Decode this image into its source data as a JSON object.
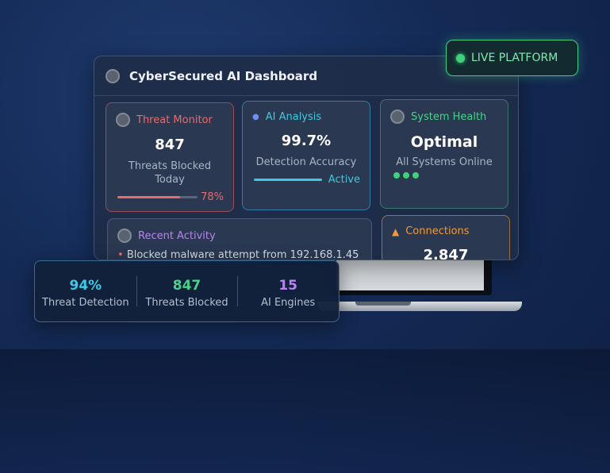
{
  "badge": {
    "label": "LIVE PLATFORM"
  },
  "dashboard": {
    "title": "CyberSecured AI Dashboard",
    "threat_monitor": {
      "title": "Threat Monitor",
      "value": "847",
      "sub": "Threats Blocked Today",
      "progress_label": "78%",
      "progress": 0.78,
      "color": "#e96a6a"
    },
    "ai_analysis": {
      "title": "AI Analysis",
      "value": "99.7%",
      "sub": "Detection Accuracy",
      "status": "Active",
      "color": "#3ec9e0"
    },
    "system_health": {
      "title": "System Health",
      "value": "Optimal",
      "sub": "All Systems Online",
      "color": "#45d38a"
    },
    "recent_activity": {
      "title": "Recent Activity",
      "entry": "Blocked malware attempt from 192.168.1.45",
      "color": "#b784f0"
    },
    "connections": {
      "title": "Connections",
      "value": "2,847",
      "color": "#ef9a3c"
    }
  },
  "stats": [
    {
      "value": "94%",
      "label": "Threat Detection",
      "color": "#3ec9e8"
    },
    {
      "value": "847",
      "label": "Threats Blocked",
      "color": "#49d18a"
    },
    {
      "value": "15",
      "label": "AI Engines",
      "color": "#b784f0"
    }
  ]
}
